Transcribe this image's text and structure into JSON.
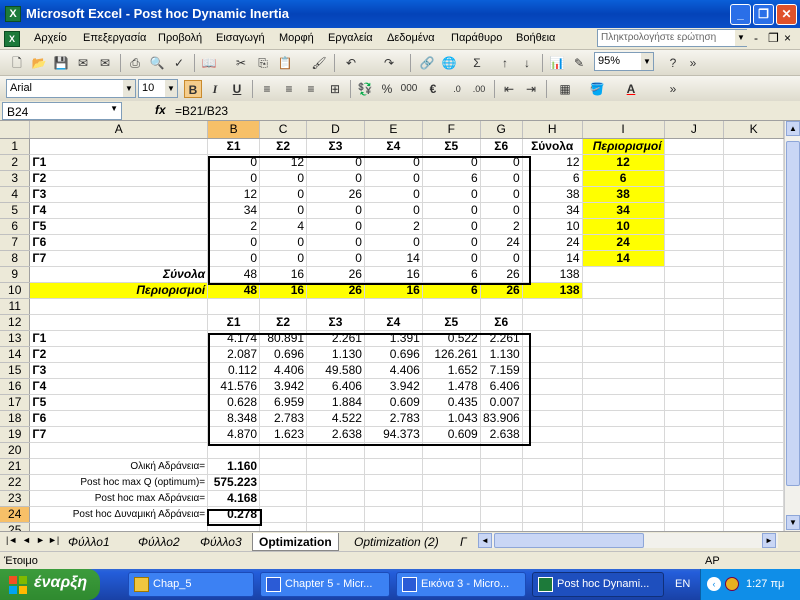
{
  "window": {
    "title": "Microsoft Excel - Post hoc Dynamic Inertia",
    "min": "_",
    "restore": "❐",
    "close": "✕"
  },
  "menu": {
    "items": [
      "Αρχείο",
      "Επεξεργασία",
      "Προβολή",
      "Εισαγωγή",
      "Μορφή",
      "Εργαλεία",
      "Δεδομένα",
      "Παράθυρο",
      "Βοήθεια"
    ],
    "ask_placeholder": "Πληκτρολογήστε ερώτηση"
  },
  "toolbar": {
    "zoom": "95%",
    "font_name": "Arial",
    "font_size": "10",
    "bold": "B",
    "italic": "I",
    "underline": "U",
    "percent": "%",
    "thousands": "000",
    "euro": "€"
  },
  "formula_bar": {
    "name_box": "B24",
    "fx": "fx",
    "formula": "=B21/B23"
  },
  "columns": [
    "A",
    "B",
    "C",
    "D",
    "E",
    "F",
    "G",
    "H",
    "I",
    "J",
    "K"
  ],
  "rows": [
    {
      "n": "1",
      "cells": [
        "",
        "Σ1",
        "Σ2",
        "Σ3",
        "Σ4",
        "Σ5",
        "Σ6",
        "Σύνολα",
        "Περιορισμοί",
        "",
        ""
      ]
    },
    {
      "n": "2",
      "cells": [
        "Γ1",
        "0",
        "12",
        "0",
        "0",
        "0",
        "0",
        "12",
        "12",
        "",
        ""
      ]
    },
    {
      "n": "3",
      "cells": [
        "Γ2",
        "0",
        "0",
        "0",
        "0",
        "6",
        "0",
        "6",
        "6",
        "",
        ""
      ]
    },
    {
      "n": "4",
      "cells": [
        "Γ3",
        "12",
        "0",
        "26",
        "0",
        "0",
        "0",
        "38",
        "38",
        "",
        ""
      ]
    },
    {
      "n": "5",
      "cells": [
        "Γ4",
        "34",
        "0",
        "0",
        "0",
        "0",
        "0",
        "34",
        "34",
        "",
        ""
      ]
    },
    {
      "n": "6",
      "cells": [
        "Γ5",
        "2",
        "4",
        "0",
        "2",
        "0",
        "2",
        "10",
        "10",
        "",
        ""
      ]
    },
    {
      "n": "7",
      "cells": [
        "Γ6",
        "0",
        "0",
        "0",
        "0",
        "0",
        "24",
        "24",
        "24",
        "",
        ""
      ]
    },
    {
      "n": "8",
      "cells": [
        "Γ7",
        "0",
        "0",
        "0",
        "14",
        "0",
        "0",
        "14",
        "14",
        "",
        ""
      ]
    },
    {
      "n": "9",
      "cells": [
        "Σύνολα",
        "48",
        "16",
        "26",
        "16",
        "6",
        "26",
        "138",
        "",
        "",
        ""
      ]
    },
    {
      "n": "10",
      "cells": [
        "Περιορισμοί",
        "48",
        "16",
        "26",
        "16",
        "6",
        "26",
        "138",
        "",
        "",
        ""
      ]
    },
    {
      "n": "11",
      "cells": [
        "",
        "",
        "",
        "",
        "",
        "",
        "",
        "",
        "",
        "",
        ""
      ]
    },
    {
      "n": "12",
      "cells": [
        "",
        "Σ1",
        "Σ2",
        "Σ3",
        "Σ4",
        "Σ5",
        "Σ6",
        "",
        "",
        "",
        ""
      ]
    },
    {
      "n": "13",
      "cells": [
        "Γ1",
        "4.174",
        "80.891",
        "2.261",
        "1.391",
        "0.522",
        "2.261",
        "",
        "",
        "",
        ""
      ]
    },
    {
      "n": "14",
      "cells": [
        "Γ2",
        "2.087",
        "0.696",
        "1.130",
        "0.696",
        "126.261",
        "1.130",
        "",
        "",
        "",
        ""
      ]
    },
    {
      "n": "15",
      "cells": [
        "Γ3",
        "0.112",
        "4.406",
        "49.580",
        "4.406",
        "1.652",
        "7.159",
        "",
        "",
        "",
        ""
      ]
    },
    {
      "n": "16",
      "cells": [
        "Γ4",
        "41.576",
        "3.942",
        "6.406",
        "3.942",
        "1.478",
        "6.406",
        "",
        "",
        "",
        ""
      ]
    },
    {
      "n": "17",
      "cells": [
        "Γ5",
        "0.628",
        "6.959",
        "1.884",
        "0.609",
        "0.435",
        "0.007",
        "",
        "",
        "",
        ""
      ]
    },
    {
      "n": "18",
      "cells": [
        "Γ6",
        "8.348",
        "2.783",
        "4.522",
        "2.783",
        "1.043",
        "83.906",
        "",
        "",
        "",
        ""
      ]
    },
    {
      "n": "19",
      "cells": [
        "Γ7",
        "4.870",
        "1.623",
        "2.638",
        "94.373",
        "0.609",
        "2.638",
        "",
        "",
        "",
        ""
      ]
    },
    {
      "n": "20",
      "cells": [
        "",
        "",
        "",
        "",
        "",
        "",
        "",
        "",
        "",
        "",
        ""
      ]
    },
    {
      "n": "21",
      "cells": [
        "Ολική Αδράνεια=",
        "1.160",
        "",
        "",
        "",
        "",
        "",
        "",
        "",
        "",
        ""
      ]
    },
    {
      "n": "22",
      "cells": [
        "Post hoc max Q (optimum)=",
        "575.223",
        "",
        "",
        "",
        "",
        "",
        "",
        "",
        "",
        ""
      ]
    },
    {
      "n": "23",
      "cells": [
        "Post hoc max Αδράνεια=",
        "4.168",
        "",
        "",
        "",
        "",
        "",
        "",
        "",
        "",
        ""
      ]
    },
    {
      "n": "24",
      "cells": [
        "Post hoc Δυναμική Αδράνεια=",
        "0.278",
        "",
        "",
        "",
        "",
        "",
        "",
        "",
        "",
        ""
      ]
    },
    {
      "n": "25",
      "cells": [
        "",
        "",
        "",
        "",
        "",
        "",
        "",
        "",
        "",
        "",
        ""
      ]
    }
  ],
  "sheet_tabs": {
    "nav": [
      "|◄",
      "◄",
      "►",
      "►|"
    ],
    "tabs": [
      "Φύλλο1",
      "Φύλλο2",
      "Φύλλο3",
      "Optimization",
      "Optimization (2)",
      "Γ"
    ],
    "active": "Optimization"
  },
  "status": {
    "ready": "Έτοιμο",
    "mode": "AP"
  },
  "taskbar": {
    "start": "έναρξη",
    "tasks": [
      "Chap_5",
      "Chapter 5 - Micr...",
      "Εικόνα 3 - Micro...",
      "Post hoc Dynami..."
    ],
    "lang": "EN",
    "clock": "1:27 πμ"
  },
  "colors": {
    "highlight": "#ffff00",
    "selected_header": "#f7c068",
    "title_blue": "#0a5fd8"
  }
}
